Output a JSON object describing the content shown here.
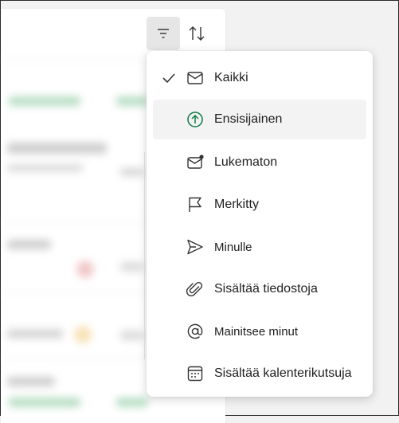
{
  "toolbar": {
    "filter_icon": "filter-icon",
    "sort_icon": "sort-arrows-icon"
  },
  "filter_menu": {
    "items": [
      {
        "label": "Kaikki",
        "icon": "mail-icon",
        "selected": true
      },
      {
        "label": "Ensisijainen",
        "icon": "arrow-up-circle-icon",
        "selected": false
      },
      {
        "label": "Lukematon",
        "icon": "mail-unread-icon",
        "selected": false
      },
      {
        "label": "Merkitty",
        "icon": "flag-icon",
        "selected": false
      },
      {
        "label": "Minulle",
        "icon": "send-icon",
        "selected": false
      },
      {
        "label": "Sisältää tiedostoja",
        "icon": "paperclip-icon",
        "selected": false
      },
      {
        "label": "Mainitsee minut",
        "icon": "at-icon",
        "selected": false
      },
      {
        "label": "Sisältää kalenterikutsuja",
        "icon": "calendar-icon",
        "selected": false
      }
    ],
    "accent_color": "#107c41"
  }
}
